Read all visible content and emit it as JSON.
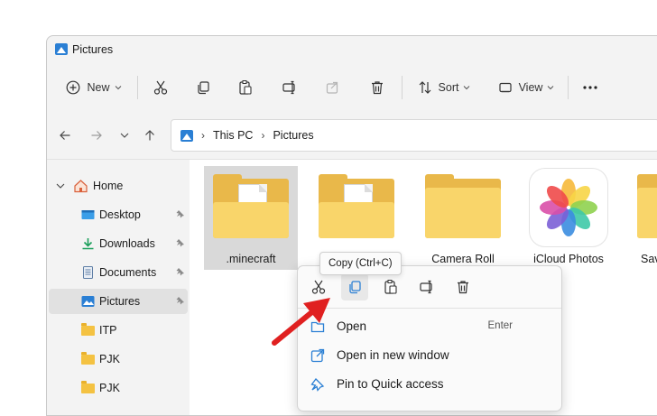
{
  "window": {
    "title": "Pictures"
  },
  "toolbar": {
    "new_label": "New",
    "sort_label": "Sort",
    "view_label": "View"
  },
  "address": {
    "crumbs": [
      "This PC",
      "Pictures"
    ]
  },
  "sidebar": {
    "items": [
      {
        "label": "Home",
        "icon": "home-icon",
        "pinned": false
      },
      {
        "label": "Desktop",
        "icon": "desktop-icon",
        "pinned": true
      },
      {
        "label": "Downloads",
        "icon": "downloads-icon",
        "pinned": true
      },
      {
        "label": "Documents",
        "icon": "documents-icon",
        "pinned": true
      },
      {
        "label": "Pictures",
        "icon": "pictures-icon",
        "pinned": true,
        "selected": true
      },
      {
        "label": "ITP",
        "icon": "folder-icon",
        "pinned": false
      },
      {
        "label": "PJK",
        "icon": "folder-icon",
        "pinned": false
      },
      {
        "label": "PJK",
        "icon": "folder-icon",
        "pinned": false
      }
    ]
  },
  "content": {
    "items": [
      {
        "label": ".minecraft",
        "type": "folder",
        "selected": true
      },
      {
        "label": "",
        "type": "folder"
      },
      {
        "label": "Camera Roll",
        "type": "folder"
      },
      {
        "label": "iCloud Photos",
        "type": "photos-app"
      },
      {
        "label": "Sav",
        "type": "folder"
      }
    ]
  },
  "context_menu": {
    "tooltip": "Copy (Ctrl+C)",
    "actions": [
      "cut",
      "copy",
      "paste",
      "rename",
      "delete"
    ],
    "items": [
      {
        "label": "Open",
        "shortcut": "Enter",
        "icon": "folder-open-icon"
      },
      {
        "label": "Open in new window",
        "shortcut": "",
        "icon": "new-window-icon"
      },
      {
        "label": "Pin to Quick access",
        "shortcut": "",
        "icon": "pin-icon"
      }
    ]
  },
  "colors": {
    "accent": "#2a7fd4",
    "folder": "#f9d56a",
    "arrow": "#e02020"
  }
}
